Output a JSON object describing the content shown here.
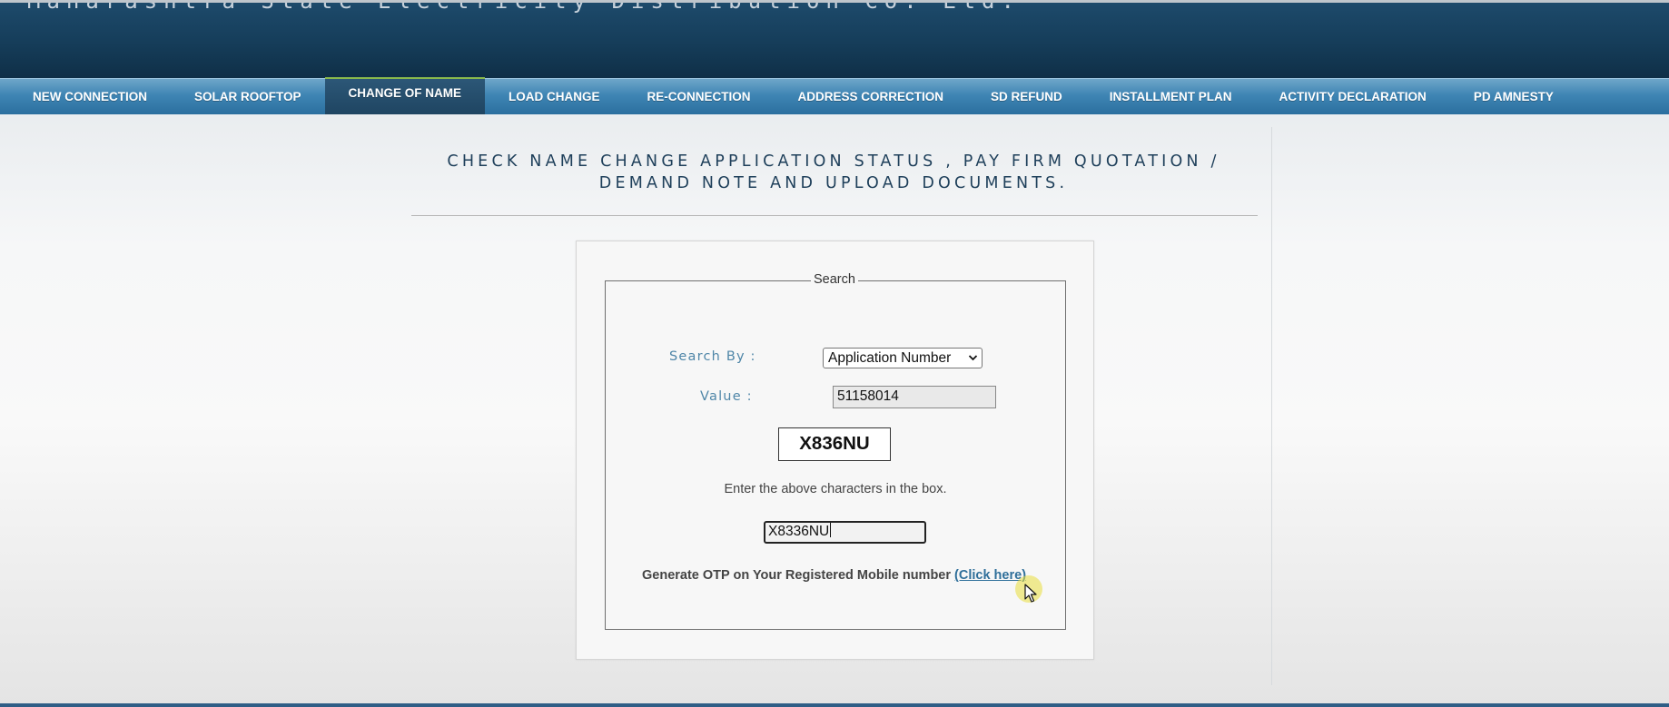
{
  "header": {
    "title": "Maharashtra State Electricity Distribution Co. Ltd."
  },
  "nav": {
    "items": [
      {
        "label": "NEW CONNECTION",
        "active": false
      },
      {
        "label": "SOLAR ROOFTOP",
        "active": false
      },
      {
        "label": "CHANGE OF NAME",
        "active": true
      },
      {
        "label": "LOAD CHANGE",
        "active": false
      },
      {
        "label": "RE-CONNECTION",
        "active": false
      },
      {
        "label": "ADDRESS CORRECTION",
        "active": false
      },
      {
        "label": "SD REFUND",
        "active": false
      },
      {
        "label": "INSTALLMENT PLAN",
        "active": false
      },
      {
        "label": "ACTIVITY DECLARATION",
        "active": false
      },
      {
        "label": "PD AMNESTY",
        "active": false
      }
    ]
  },
  "page": {
    "title_line1": "CHECK NAME CHANGE APPLICATION STATUS , PAY FIRM QUOTATION /",
    "title_line2": "DEMAND NOTE AND UPLOAD DOCUMENTS."
  },
  "search": {
    "legend": "Search",
    "search_by_label": "Search By :",
    "search_by_value": "Application Number",
    "value_label": "Value :",
    "value": "51158014",
    "captcha_text": "X836NU",
    "captcha_hint": "Enter the above characters in the box.",
    "captcha_input_value": "X8336NU",
    "otp_text": "Generate OTP on Your Registered Mobile number",
    "otp_link": "(Click here)"
  },
  "colors": {
    "header_bg": "#163e5b",
    "nav_bg": "#3f85b4",
    "nav_active_bg": "#1f4562",
    "label_color": "#4f86a8",
    "link_color": "#2f6f9a",
    "cursor_highlight": "#e9de3c"
  },
  "icons": {
    "dropdown": "chevron-down-icon",
    "pointer": "mouse-cursor-icon"
  }
}
